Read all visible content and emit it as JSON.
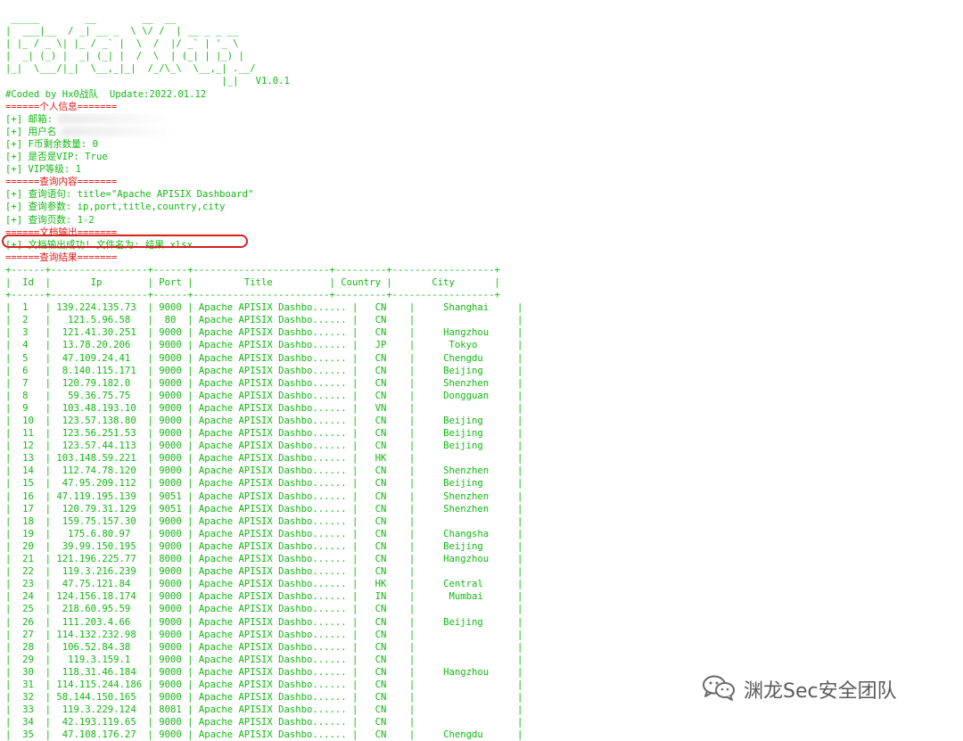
{
  "colors": {
    "primary_text": "#14b814",
    "section_header": "#e01818",
    "highlight_ring": "#d42020",
    "watermark": "#5a5a5a"
  },
  "banner": [
    " _____        __        __  __",
    "|  ___|__  / _| __ _  \\ \\/ /  | __ _ _ __",
    "| |_ / _ \\| |_ / _` |  \\  /  |/ _` | '_ \\",
    "|  _| (_) |  _| (_| |  /  \\  | (_| | |_) |",
    "|_|  \\___/|_|  \\__,_|_|  /_/\\_\\  \\__,_| .__/",
    "                                      |_|   V1.0.1"
  ],
  "coded_line": "#Coded by Hx0战队  Update:2022.01.12",
  "sections": {
    "personal": "======个人信息=======",
    "query": "======查询内容=======",
    "output": "======文档输出=======",
    "results": "======查询结果======="
  },
  "personal": {
    "email": "[+] 邮箱:",
    "username": "[+] 用户名",
    "fcoins": "[+] F币剩余数量: 0",
    "is_vip": "[+] 是否是VIP: True",
    "vip_level": "[+] VIP等级: 1"
  },
  "query": {
    "statement": "[+] 查询语句: title=\"Apache APISIX Dashboard\"",
    "params": "[+] 查询参数: ip,port,title,country,city",
    "pages": "[+] 查询页数: 1-2"
  },
  "output": {
    "success": "[+] 文档输出成功! 文件名为: 结果.xlsx"
  },
  "table": {
    "border": "+------+-----------------+------+------------------------+---------+------------------+",
    "header": {
      "id": "Id",
      "ip": "Ip",
      "port": "Port",
      "title": "Title",
      "country": "Country",
      "city": "City"
    },
    "rows": [
      {
        "id": "1",
        "ip": "139.224.135.73",
        "port": "9000",
        "title": "Apache APISIX Dashbo......",
        "country": "CN",
        "city": "Shanghai"
      },
      {
        "id": "2",
        "ip": "121.5.96.58",
        "port": "80",
        "title": "Apache APISIX Dashbo......",
        "country": "CN",
        "city": ""
      },
      {
        "id": "3",
        "ip": "121.41.30.251",
        "port": "9000",
        "title": "Apache APISIX Dashbo......",
        "country": "CN",
        "city": "Hangzhou"
      },
      {
        "id": "4",
        "ip": "13.78.20.206",
        "port": "9000",
        "title": "Apache APISIX Dashbo......",
        "country": "JP",
        "city": "Tokyo"
      },
      {
        "id": "5",
        "ip": "47.109.24.41",
        "port": "9000",
        "title": "Apache APISIX Dashbo......",
        "country": "CN",
        "city": "Chengdu"
      },
      {
        "id": "6",
        "ip": "8.140.115.171",
        "port": "9000",
        "title": "Apache APISIX Dashbo......",
        "country": "CN",
        "city": "Beijing"
      },
      {
        "id": "7",
        "ip": "120.79.182.0",
        "port": "9000",
        "title": "Apache APISIX Dashbo......",
        "country": "CN",
        "city": "Shenzhen"
      },
      {
        "id": "8",
        "ip": "59.36.75.75",
        "port": "9000",
        "title": "Apache APISIX Dashbo......",
        "country": "CN",
        "city": "Dongguan"
      },
      {
        "id": "9",
        "ip": "103.48.193.10",
        "port": "9000",
        "title": "Apache APISIX Dashbo......",
        "country": "VN",
        "city": ""
      },
      {
        "id": "10",
        "ip": "123.57.138.80",
        "port": "9000",
        "title": "Apache APISIX Dashbo......",
        "country": "CN",
        "city": "Beijing"
      },
      {
        "id": "11",
        "ip": "123.56.251.53",
        "port": "9000",
        "title": "Apache APISIX Dashbo......",
        "country": "CN",
        "city": "Beijing"
      },
      {
        "id": "12",
        "ip": "123.57.44.113",
        "port": "9000",
        "title": "Apache APISIX Dashbo......",
        "country": "CN",
        "city": "Beijing"
      },
      {
        "id": "13",
        "ip": "103.148.59.221",
        "port": "9000",
        "title": "Apache APISIX Dashbo......",
        "country": "HK",
        "city": ""
      },
      {
        "id": "14",
        "ip": "112.74.78.120",
        "port": "9000",
        "title": "Apache APISIX Dashbo......",
        "country": "CN",
        "city": "Shenzhen"
      },
      {
        "id": "15",
        "ip": "47.95.209.112",
        "port": "9000",
        "title": "Apache APISIX Dashbo......",
        "country": "CN",
        "city": "Beijing"
      },
      {
        "id": "16",
        "ip": "47.119.195.139",
        "port": "9051",
        "title": "Apache APISIX Dashbo......",
        "country": "CN",
        "city": "Shenzhen"
      },
      {
        "id": "17",
        "ip": "120.79.31.129",
        "port": "9051",
        "title": "Apache APISIX Dashbo......",
        "country": "CN",
        "city": "Shenzhen"
      },
      {
        "id": "18",
        "ip": "159.75.157.30",
        "port": "9000",
        "title": "Apache APISIX Dashbo......",
        "country": "CN",
        "city": ""
      },
      {
        "id": "19",
        "ip": "175.6.80.97",
        "port": "9000",
        "title": "Apache APISIX Dashbo......",
        "country": "CN",
        "city": "Changsha"
      },
      {
        "id": "20",
        "ip": "39.99.150.195",
        "port": "9000",
        "title": "Apache APISIX Dashbo......",
        "country": "CN",
        "city": "Beijing"
      },
      {
        "id": "21",
        "ip": "121.196.225.77",
        "port": "8000",
        "title": "Apache APISIX Dashbo......",
        "country": "CN",
        "city": "Hangzhou"
      },
      {
        "id": "22",
        "ip": "119.3.216.239",
        "port": "9000",
        "title": "Apache APISIX Dashbo......",
        "country": "CN",
        "city": ""
      },
      {
        "id": "23",
        "ip": "47.75.121.84",
        "port": "9000",
        "title": "Apache APISIX Dashbo......",
        "country": "HK",
        "city": "Central"
      },
      {
        "id": "24",
        "ip": "124.156.18.174",
        "port": "9000",
        "title": "Apache APISIX Dashbo......",
        "country": "IN",
        "city": "Mumbai"
      },
      {
        "id": "25",
        "ip": "218.60.95.59",
        "port": "9000",
        "title": "Apache APISIX Dashbo......",
        "country": "CN",
        "city": ""
      },
      {
        "id": "26",
        "ip": "111.203.4.66",
        "port": "9000",
        "title": "Apache APISIX Dashbo......",
        "country": "CN",
        "city": "Beijing"
      },
      {
        "id": "27",
        "ip": "114.132.232.98",
        "port": "9000",
        "title": "Apache APISIX Dashbo......",
        "country": "CN",
        "city": ""
      },
      {
        "id": "28",
        "ip": "106.52.84.38",
        "port": "9000",
        "title": "Apache APISIX Dashbo......",
        "country": "CN",
        "city": ""
      },
      {
        "id": "29",
        "ip": "119.3.159.1",
        "port": "9000",
        "title": "Apache APISIX Dashbo......",
        "country": "CN",
        "city": ""
      },
      {
        "id": "30",
        "ip": "118.31.46.184",
        "port": "9000",
        "title": "Apache APISIX Dashbo......",
        "country": "CN",
        "city": "Hangzhou"
      },
      {
        "id": "31",
        "ip": "114.115.244.186",
        "port": "9000",
        "title": "Apache APISIX Dashbo......",
        "country": "CN",
        "city": ""
      },
      {
        "id": "32",
        "ip": "58.144.150.165",
        "port": "9000",
        "title": "Apache APISIX Dashbo......",
        "country": "CN",
        "city": ""
      },
      {
        "id": "33",
        "ip": "119.3.229.124",
        "port": "8081",
        "title": "Apache APISIX Dashbo......",
        "country": "CN",
        "city": ""
      },
      {
        "id": "34",
        "ip": "42.193.119.65",
        "port": "9000",
        "title": "Apache APISIX Dashbo......",
        "country": "CN",
        "city": ""
      },
      {
        "id": "35",
        "ip": "47.108.176.27",
        "port": "9000",
        "title": "Apache APISIX Dashbo......",
        "country": "CN",
        "city": "Chengdu"
      }
    ]
  },
  "watermark": {
    "icon": "wechat-icon",
    "text": "渊龙Sec安全团队"
  }
}
